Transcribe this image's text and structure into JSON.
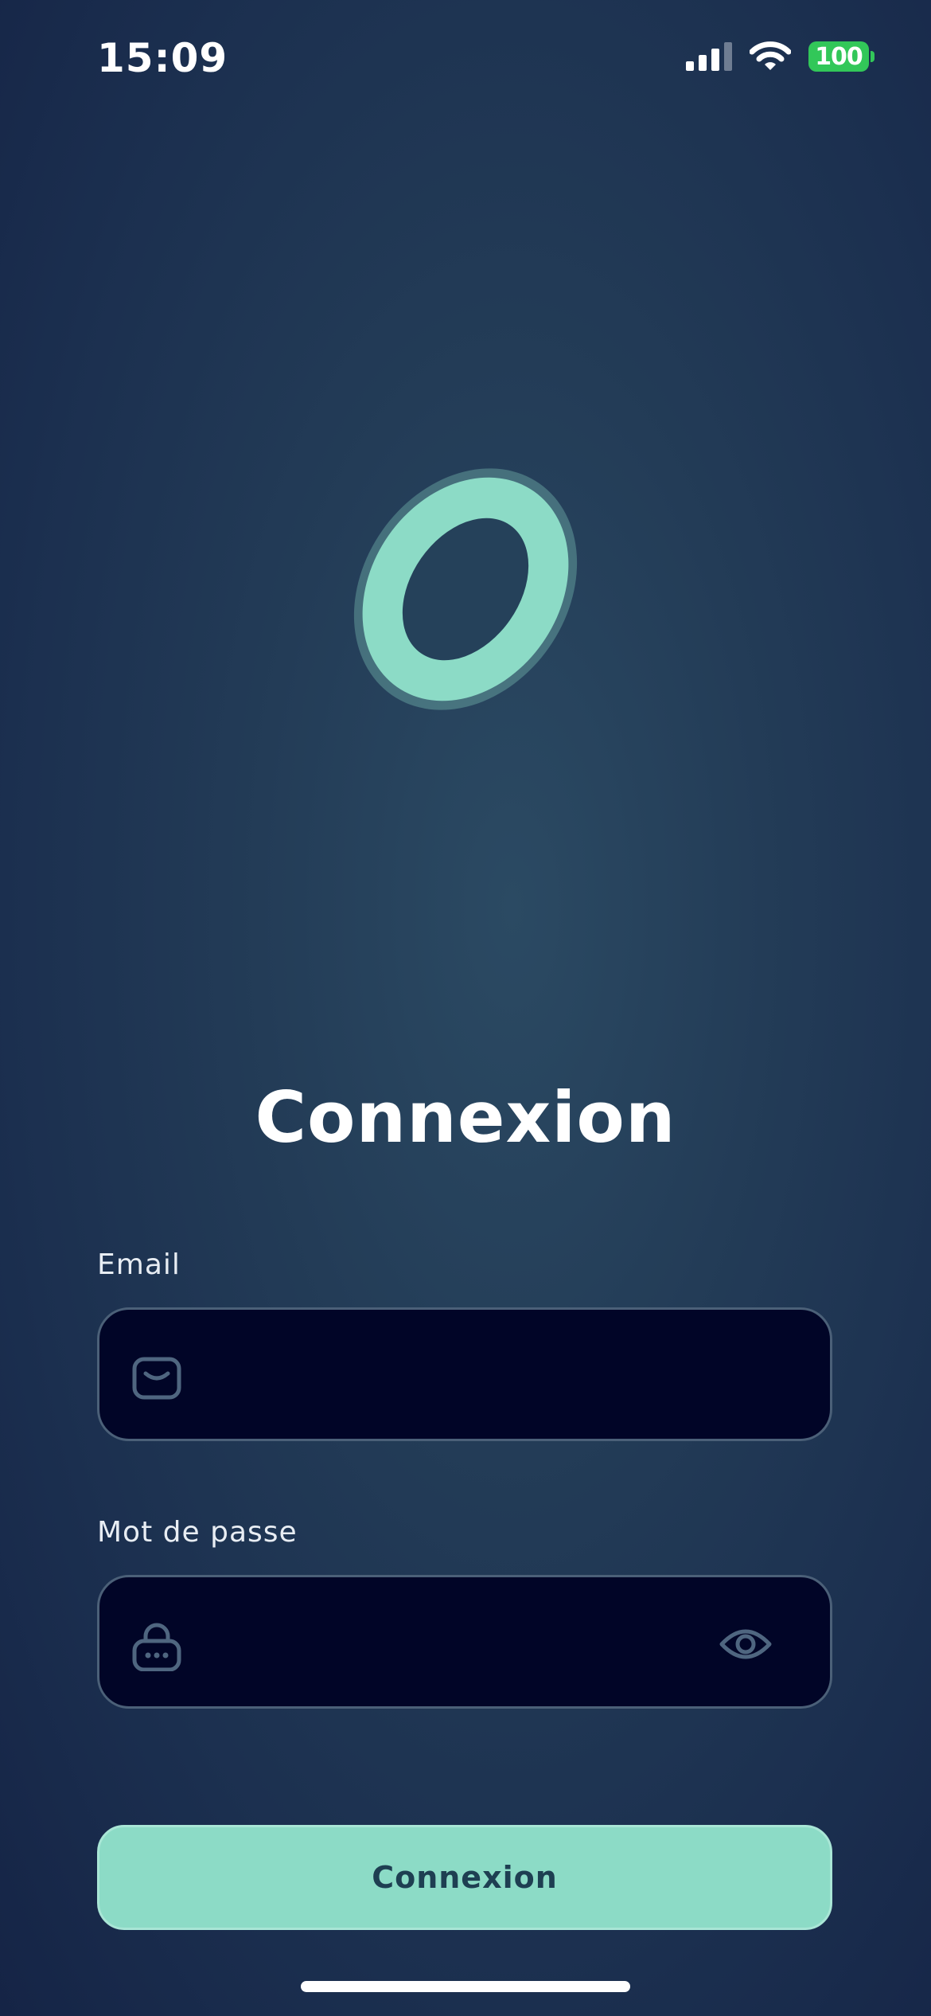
{
  "status_bar": {
    "time": "15:09",
    "battery": "100",
    "icons": [
      "cellular-signal-icon",
      "wifi-icon",
      "battery-icon"
    ]
  },
  "logo": {
    "icon": "app-logo-ring-icon",
    "color": "#8cdbc6"
  },
  "login": {
    "title": "Connexion",
    "email": {
      "label": "Email",
      "value": "",
      "placeholder": "",
      "icon": "mail-icon"
    },
    "password": {
      "label": "Mot de passe",
      "value": "",
      "placeholder": "",
      "icon": "lock-icon",
      "toggle_icon": "eye-icon"
    },
    "submit_label": "Connexion"
  },
  "colors": {
    "accent": "#8cdbc6",
    "input_background": "#010527",
    "input_border": "#4b6078",
    "button_text": "#1e3f52"
  }
}
